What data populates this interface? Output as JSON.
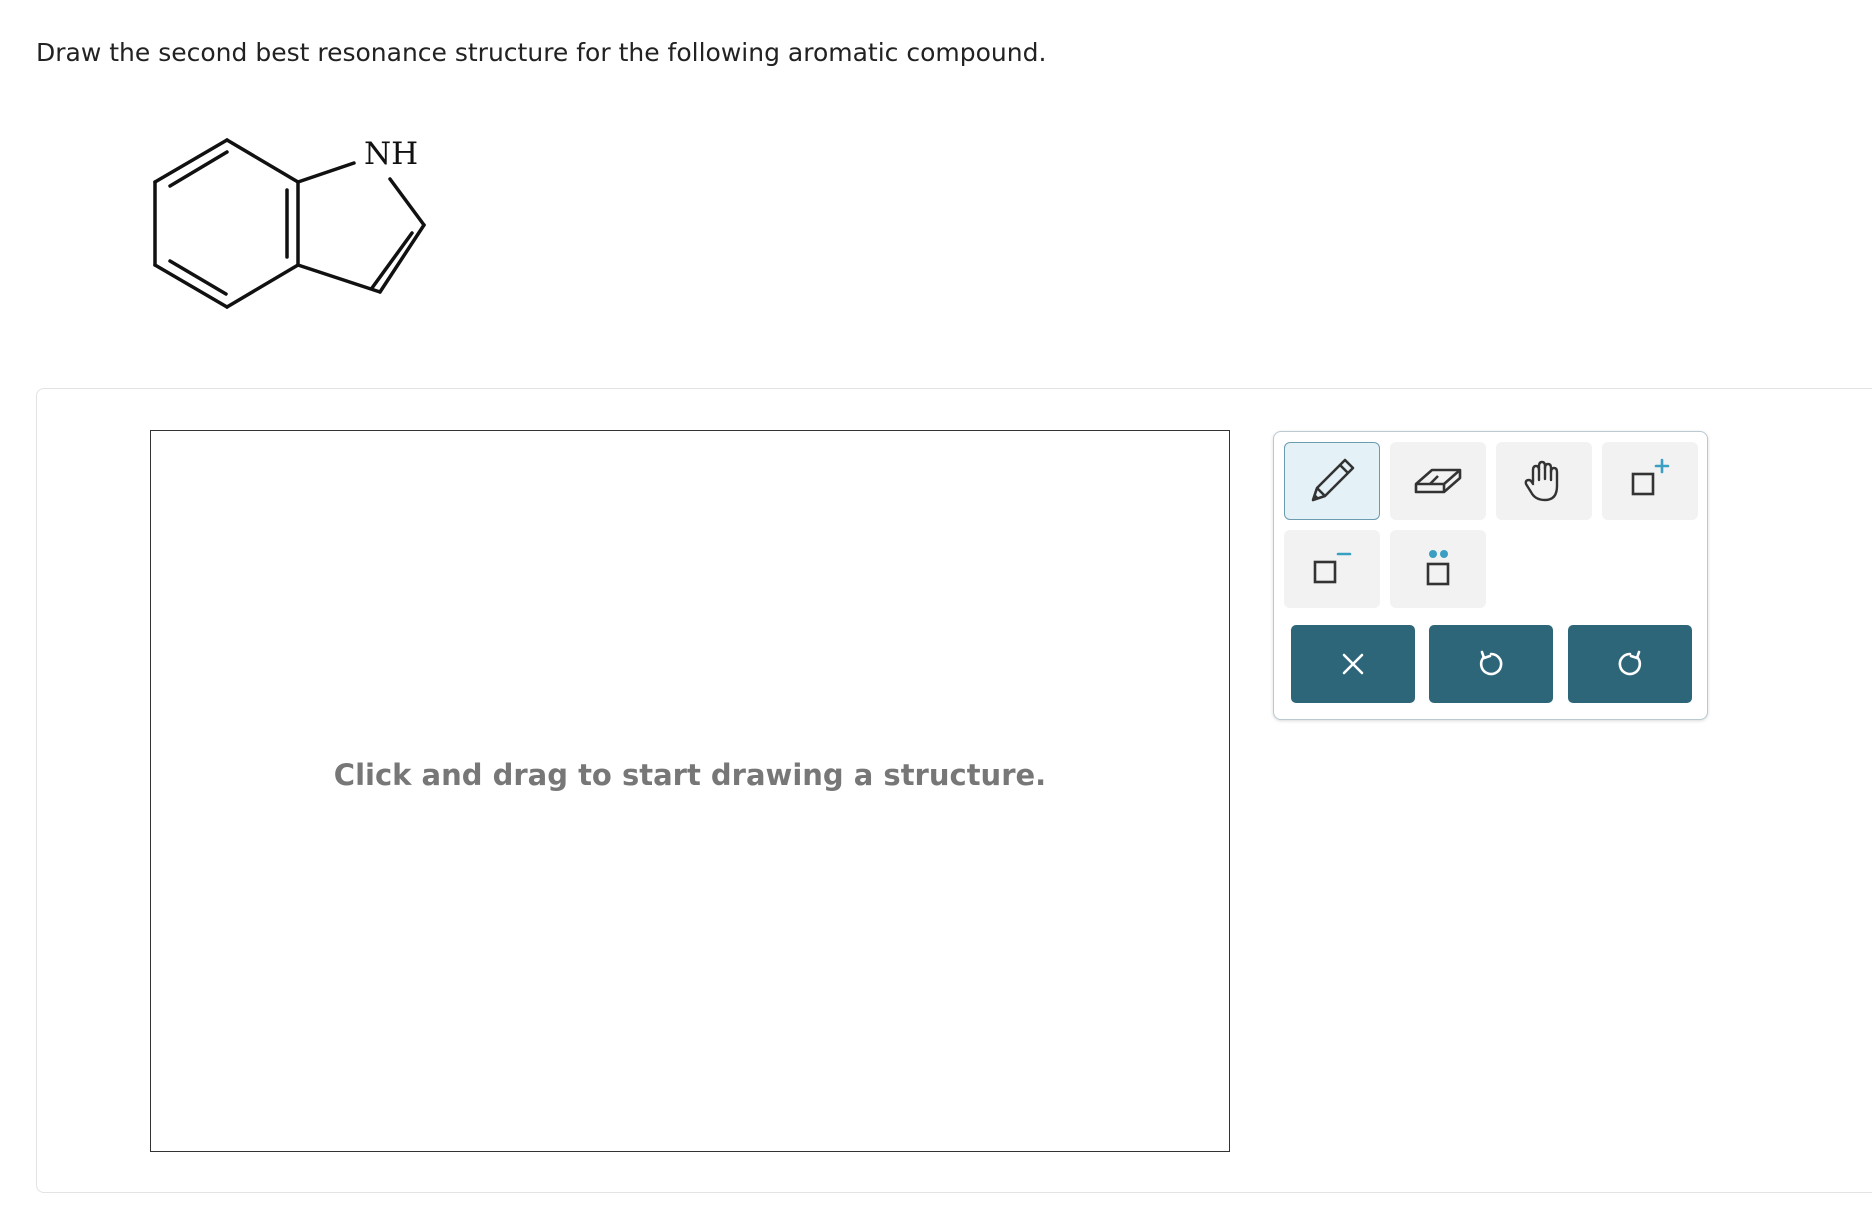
{
  "question": {
    "text": "Draw the second best resonance structure for the following aromatic compound."
  },
  "molecule": {
    "heteroatom_label": "NH"
  },
  "canvas": {
    "hint": "Click and drag to start drawing a structure."
  },
  "toolbar": {
    "tools": [
      {
        "name": "pencil-tool",
        "icon": "pencil-icon",
        "selected": true
      },
      {
        "name": "eraser-tool",
        "icon": "eraser-icon",
        "selected": false
      },
      {
        "name": "pan-tool",
        "icon": "hand-icon",
        "selected": false
      },
      {
        "name": "positive-charge-tool",
        "icon": "positive-charge-icon",
        "selected": false
      },
      {
        "name": "negative-charge-tool",
        "icon": "negative-charge-icon",
        "selected": false
      },
      {
        "name": "lone-pair-tool",
        "icon": "lone-pair-icon",
        "selected": false
      }
    ],
    "actions": [
      {
        "name": "clear-button",
        "icon": "close-icon"
      },
      {
        "name": "undo-button",
        "icon": "undo-icon"
      },
      {
        "name": "redo-button",
        "icon": "redo-icon"
      }
    ]
  },
  "colors": {
    "action_button": "#2d6679",
    "accent": "#3a9fc2",
    "tool_bg": "#f2f2f2",
    "active_tool_bg": "#e4f1f6"
  }
}
